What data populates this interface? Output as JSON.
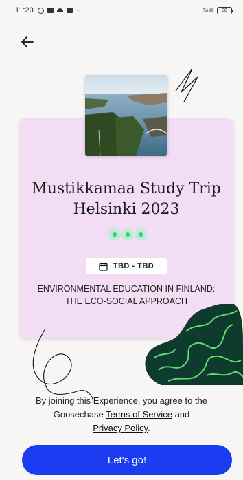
{
  "status_bar": {
    "time": "11:20",
    "more": "···",
    "signal": "5ull",
    "battery": "88"
  },
  "trip": {
    "title": "Mustikkamaa Study Trip Helsinki 2023",
    "date_range": "TBD - TBD",
    "subtitle": "ENVIRONMENTAL EDUCATION IN FINLAND: THE ECO-SOCIAL APPROACH",
    "badge_icons": [
      "team-avatar-icon",
      "team-avatar-icon",
      "team-avatar-icon"
    ]
  },
  "terms": {
    "prefix": "By joining this Experience, you agree to the Goosechase",
    "tos_label": "Terms of Service",
    "and": "and",
    "privacy_label": "Privacy Policy",
    "suffix": "."
  },
  "cta": {
    "label": "Let's go!"
  },
  "colors": {
    "card_bg": "#f2ddf4",
    "primary_button": "#1b3cf0",
    "blob_dark": "#0f3a2e",
    "blob_line": "#5fdc6e"
  }
}
